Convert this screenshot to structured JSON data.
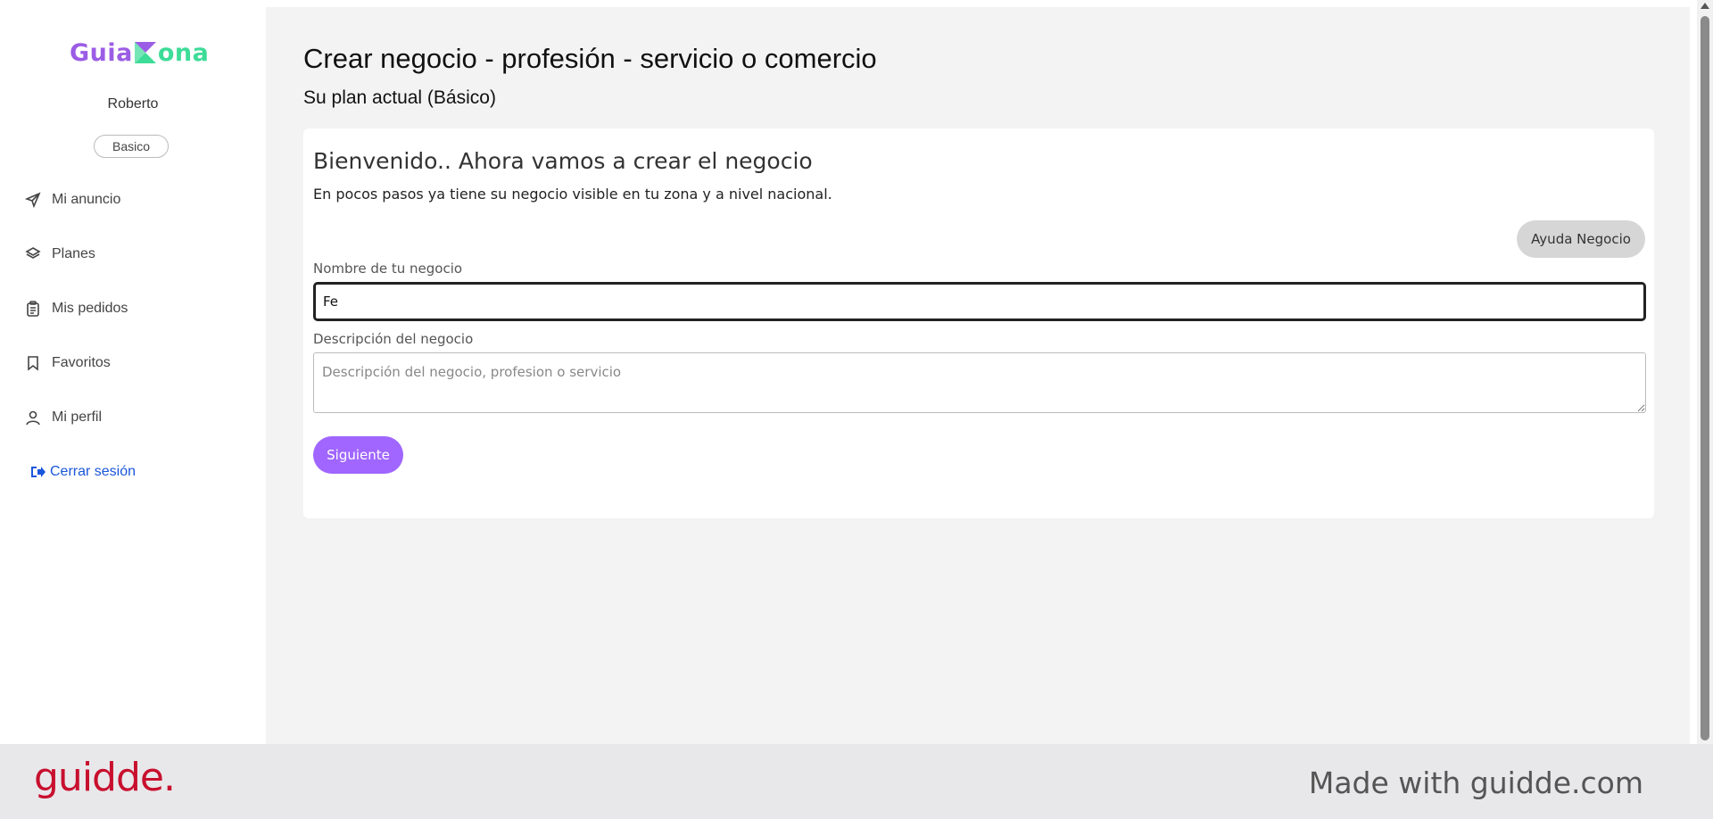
{
  "sidebar": {
    "logo_part1": "Guia",
    "logo_part2": "ona",
    "username": "Roberto",
    "plan_badge": "Basico",
    "items": [
      {
        "label": "Mi anuncio",
        "icon": "send-icon"
      },
      {
        "label": "Planes",
        "icon": "layers-icon"
      },
      {
        "label": "Mis pedidos",
        "icon": "clipboard-icon"
      },
      {
        "label": "Favoritos",
        "icon": "bookmark-icon"
      },
      {
        "label": "Mi perfil",
        "icon": "user-icon"
      }
    ],
    "logout_label": "Cerrar sesión"
  },
  "main": {
    "title": "Crear negocio - profesión - servicio o comercio",
    "plan_line": "Su plan actual (Básico)",
    "card": {
      "welcome": "Bienvenido.. Ahora vamos a crear el negocio",
      "subtitle": "En pocos pasos ya tiene su negocio visible en tu zona y a nivel nacional.",
      "help_button": "Ayuda Negocio",
      "name_label": "Nombre de tu negocio",
      "name_value": "Fe",
      "desc_label": "Descripción del negocio",
      "desc_placeholder": "Descripción del negocio, profesion o servicio",
      "next_button": "Siguiente"
    }
  },
  "footer": {
    "brand": "guidde.",
    "made_with": "Made with guidde.com"
  },
  "colors": {
    "logo_purple": "#9b5de5",
    "logo_green": "#3ddc97",
    "primary_button": "#a066ff",
    "logout_link": "#1a56db",
    "footer_brand": "#c8102e"
  }
}
